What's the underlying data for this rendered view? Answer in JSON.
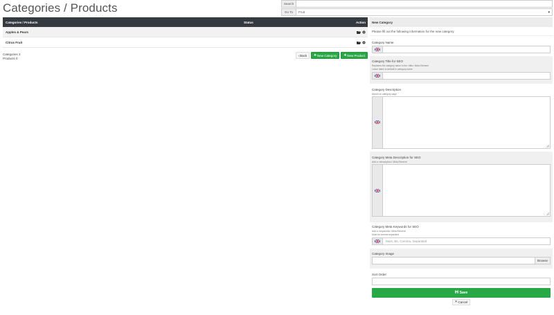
{
  "page": {
    "title": "Categories / Products"
  },
  "search": {
    "label": "Search",
    "value": ""
  },
  "goto": {
    "label": "Go To",
    "value": "Fruit"
  },
  "table": {
    "headers": {
      "name": "Categories / Products",
      "status": "Status",
      "action": "Action"
    },
    "rows": [
      {
        "name": "Apples & Pears",
        "status": ""
      },
      {
        "name": "Citrus Fruit",
        "status": ""
      }
    ]
  },
  "counts": {
    "categories": "Categories 2",
    "products": "Products 0"
  },
  "buttons": {
    "back": "Back",
    "new_category": "New Category",
    "new_product": "New Product"
  },
  "form": {
    "title": "New Category",
    "intro": "Please fill out the following information for the new category",
    "name": {
      "label": "Category Name",
      "value": ""
    },
    "seo_title": {
      "label": "Category Title for SEO",
      "help1": "Replaces the category name in the <title> Meta Element",
      "help2": "Leave blank to default to category name",
      "value": ""
    },
    "description": {
      "label": "Category Description",
      "help": "shown on category page"
    },
    "meta_description": {
      "label": "Category Meta Description for SEO",
      "help": "Add a <description> Meta Element"
    },
    "keywords": {
      "label": "Category Meta Keywords for SEO",
      "help1": "Add a <keywords> Meta Element",
      "help2": "Must be comma separated",
      "placeholder": "Must, Be, Comma, Separated"
    },
    "image": {
      "label": "Category Image",
      "browse": "Browse"
    },
    "sort": {
      "label": "Sort Order",
      "value": ""
    },
    "save": "Save",
    "cancel": "Cancel"
  },
  "colors": {
    "header": "#343a40",
    "success": "#28a745"
  }
}
